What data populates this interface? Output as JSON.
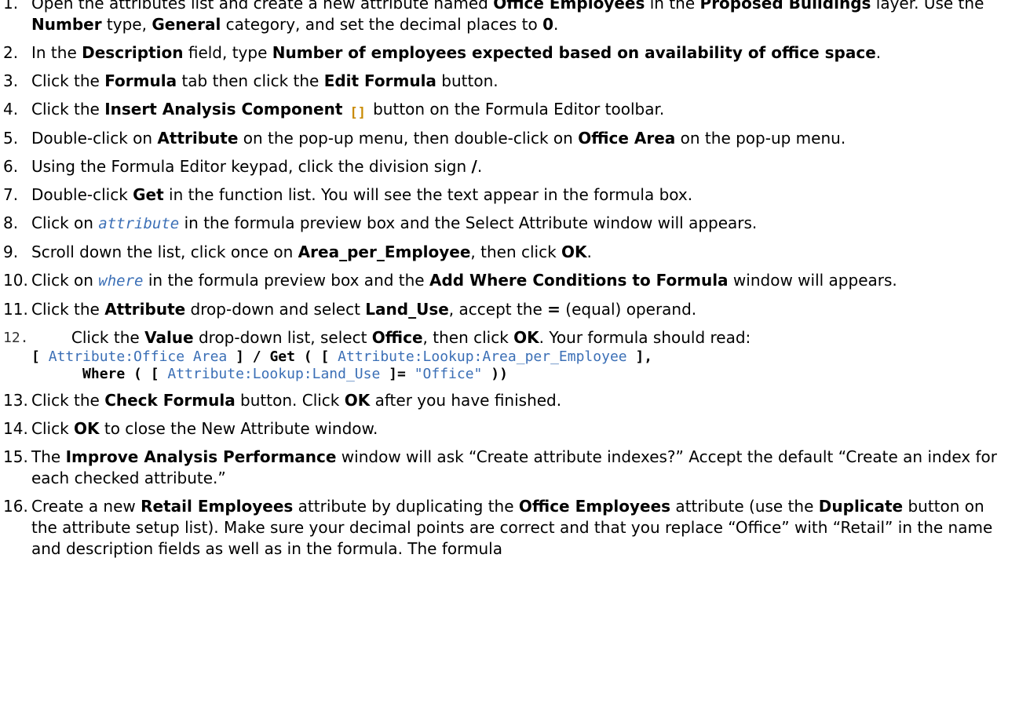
{
  "steps": [
    {
      "num": "1.",
      "parts": [
        {
          "t": "Open the attributes list and create a new attribute named "
        },
        {
          "b": "Office Employees"
        },
        {
          "t": " in the "
        },
        {
          "b": "Proposed Buildings"
        },
        {
          "t": " layer. Use the "
        },
        {
          "b": "Number"
        },
        {
          "t": " type, "
        },
        {
          "b": "General"
        },
        {
          "t": " category, and set the decimal places to "
        },
        {
          "b": "0"
        },
        {
          "t": "."
        }
      ]
    },
    {
      "num": "2.",
      "parts": [
        {
          "t": "In the "
        },
        {
          "b": "Description"
        },
        {
          "t": " field, type "
        },
        {
          "b": "Number of employees expected based on availability of office space"
        },
        {
          "t": "."
        }
      ]
    },
    {
      "num": "3.",
      "parts": [
        {
          "t": "Click the "
        },
        {
          "b": "Formula"
        },
        {
          "t": " tab then click the "
        },
        {
          "b": "Edit Formula"
        },
        {
          "t": " button."
        }
      ]
    },
    {
      "num": "4.",
      "parts": [
        {
          "t": "Click the "
        },
        {
          "b": "Insert Analysis Component"
        },
        {
          "t": " "
        },
        {
          "icon": "[]"
        },
        {
          "t": " button on the Formula Editor toolbar."
        }
      ]
    },
    {
      "num": "5.",
      "parts": [
        {
          "t": "Double-click on "
        },
        {
          "b": "Attribute"
        },
        {
          "t": " on the pop-up menu, then double-click on "
        },
        {
          "b": "Office Area"
        },
        {
          "t": " on the pop-up menu."
        }
      ]
    },
    {
      "num": "6.",
      "parts": [
        {
          "t": "Using the Formula Editor keypad, click the division sign "
        },
        {
          "b": "/"
        },
        {
          "t": "."
        }
      ]
    },
    {
      "num": "7.",
      "parts": [
        {
          "t": "Double-click "
        },
        {
          "b": "Get"
        },
        {
          "t": " in the function list. You will see the text appear in the formula box."
        }
      ]
    },
    {
      "num": "8.",
      "parts": [
        {
          "t": "Click on "
        },
        {
          "i": "attribute"
        },
        {
          "t": " in the formula preview box and the Select Attribute window will appears."
        }
      ]
    },
    {
      "num": "9.",
      "parts": [
        {
          "t": "Scroll down the list, click once on "
        },
        {
          "b": "Area_per_Employee"
        },
        {
          "t": ", then click "
        },
        {
          "b": "OK"
        },
        {
          "t": "."
        }
      ]
    },
    {
      "num": "10.",
      "parts": [
        {
          "t": "Click on "
        },
        {
          "i": "where"
        },
        {
          "t": " in the formula preview box and the "
        },
        {
          "b": "Add Where Conditions to Formula"
        },
        {
          "t": " window will appears."
        }
      ]
    },
    {
      "num": "11.",
      "parts": [
        {
          "t": "Click the "
        },
        {
          "b": "Attribute"
        },
        {
          "t": " drop-down and select "
        },
        {
          "b": "Land_Use"
        },
        {
          "t": ", accept the "
        },
        {
          "b": "="
        },
        {
          "t": " (equal) operand."
        }
      ]
    },
    {
      "num": "12.",
      "mono_num": true,
      "parts": [
        {
          "t": "        Click the "
        },
        {
          "b": "Value"
        },
        {
          "t": " drop-down list, select "
        },
        {
          "b": "Office"
        },
        {
          "t": ", then click "
        },
        {
          "b": "OK"
        },
        {
          "t": ". Your formula should read:"
        }
      ],
      "formula_lines": [
        [
          {
            "b": "[ "
          },
          {
            "c": "Attribute:Office Area"
          },
          {
            "b": " ] / Get ( [ "
          },
          {
            "c": "Attribute:Lookup:Area_per_Employee"
          },
          {
            "b": " ],"
          }
        ],
        [
          {
            "b": "      Where ( [ "
          },
          {
            "c": "Attribute:Lookup:Land_Use"
          },
          {
            "b": " ]= "
          },
          {
            "c": "\"Office\""
          },
          {
            "b": " ))"
          }
        ]
      ]
    },
    {
      "num": "13.",
      "parts": [
        {
          "t": "Click the "
        },
        {
          "b": "Check Formula"
        },
        {
          "t": " button. Click "
        },
        {
          "b": "OK"
        },
        {
          "t": " after you have finished."
        }
      ]
    },
    {
      "num": "14.",
      "parts": [
        {
          "t": "Click "
        },
        {
          "b": "OK"
        },
        {
          "t": " to close the New Attribute window."
        }
      ]
    },
    {
      "num": "15.",
      "parts": [
        {
          "t": "The "
        },
        {
          "b": "Improve Analysis Performance"
        },
        {
          "t": " window will ask “Create attribute indexes?” Accept the default “Create an index for each checked attribute.”"
        }
      ]
    },
    {
      "num": "16.",
      "parts": [
        {
          "t": "Create a new "
        },
        {
          "b": "Retail Employees"
        },
        {
          "t": " attribute by duplicating the "
        },
        {
          "b": "Office Employees"
        },
        {
          "t": " attribute (use the "
        },
        {
          "b": "Duplicate"
        },
        {
          "t": " button on the attribute setup list).  Make sure your decimal points are correct and that you replace “Office” with “Retail” in the name and description fields as well as in the formula.  The formula"
        }
      ]
    }
  ]
}
